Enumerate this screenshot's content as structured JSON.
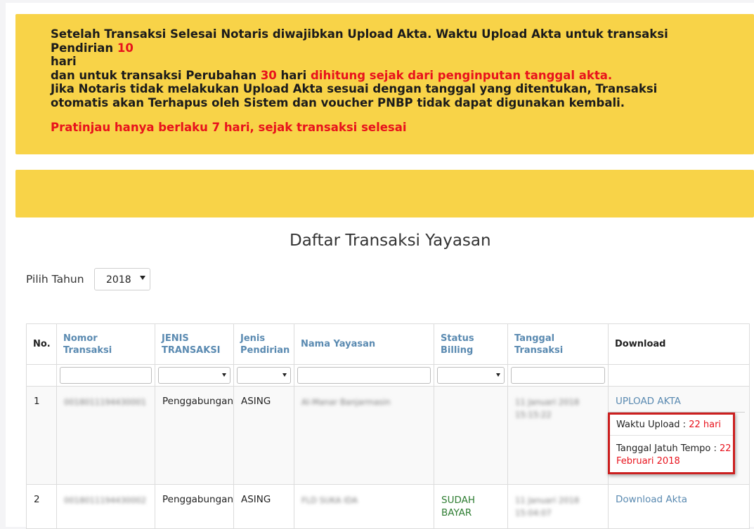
{
  "notice": {
    "line1_start": "Setelah Transaksi Selesai Notaris diwajibkan Upload Akta. Waktu Upload Akta untuk transaksi Pendirian",
    "pendirian_days": "10",
    "hari1": "hari",
    "line2_start": "dan untuk transaksi Perubahan",
    "perubahan_days": "30",
    "hari2": "hari",
    "line2_red": "dihitung sejak dari penginputan tanggal akta.",
    "line3": "Jika Notaris tidak melakukan Upload Akta sesuai dengan tanggal yang ditentukan, Transaksi otomatis akan Terhapus oleh Sistem dan voucher PNBP tidak dapat digunakan kembali.",
    "preview": "Pratinjau hanya berlaku 7 hari, sejak transaksi selesai"
  },
  "page_title": "Daftar Transaksi Yayasan",
  "year_filter": {
    "label": "Pilih Tahun",
    "value": "2018"
  },
  "table": {
    "headers": [
      "No.",
      "Nomor Transaksi",
      "JENIS TRANSAKSI",
      "Jenis Pendirian",
      "Nama Yayasan",
      "Status Billing",
      "Tanggal Transaksi",
      "Download"
    ],
    "rows": [
      {
        "no": "1",
        "nomor": "0018011194430001",
        "jenis_transaksi": "Penggabungan",
        "jenis_pendirian": "ASING",
        "nama": "Al-Manar Banjarmasin",
        "status": "",
        "tanggal": "11 Januari 2018 15:15:22",
        "download": "UPLOAD AKTA",
        "waktu_label": "Waktu Upload :",
        "waktu_value": "22 hari",
        "tempo_label": "Tanggal Jatuh Tempo :",
        "tempo_value": "22 Februari 2018"
      },
      {
        "no": "2",
        "nomor": "0018011194430002",
        "jenis_transaksi": "Penggabungan",
        "jenis_pendirian": "ASING",
        "nama": "FLD SUKA IDA",
        "status": "SUDAH BAYAR",
        "tanggal": "11 Januari 2018 15:04:07",
        "download": "Download Akta"
      }
    ]
  }
}
